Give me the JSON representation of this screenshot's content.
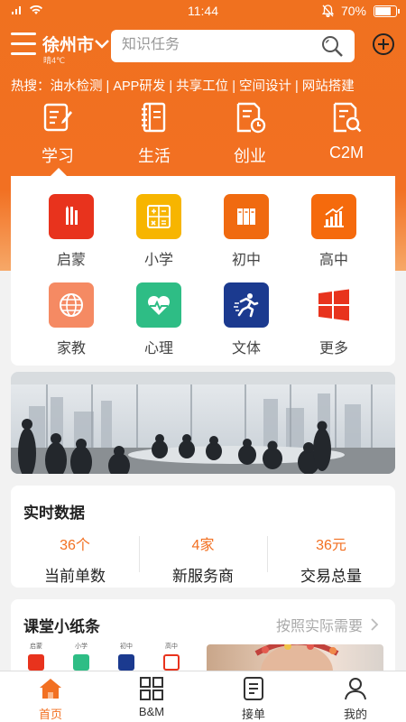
{
  "status": {
    "time": "11:44",
    "battery": "70%",
    "battery_level": 0.7
  },
  "header": {
    "city": "徐州市",
    "weather": "晴4℃",
    "search_placeholder": "知识任务"
  },
  "hot": {
    "text": "热搜：油水检测 | APP研发 | 共享工位 | 空间设计 | 网站搭建"
  },
  "categories": [
    {
      "label": "学习",
      "icon": "pencil-note-icon"
    },
    {
      "label": "生活",
      "icon": "notebook-icon"
    },
    {
      "label": "创业",
      "icon": "document-clock-icon"
    },
    {
      "label": "C2M",
      "icon": "document-search-icon"
    }
  ],
  "grid": [
    {
      "label": "启蒙",
      "color": "#e8331d",
      "icon": "crayon-icon"
    },
    {
      "label": "小学",
      "color": "#f7b500",
      "icon": "calculator-icon"
    },
    {
      "label": "初中",
      "color": "#f06a10",
      "icon": "books-icon"
    },
    {
      "label": "高中",
      "color": "#f56a0c",
      "icon": "growth-chart-icon"
    },
    {
      "label": "家教",
      "color": "#f58a63",
      "icon": "globe-icon"
    },
    {
      "label": "心理",
      "color": "#2ebd85",
      "icon": "heart-pulse-icon"
    },
    {
      "label": "文体",
      "color": "#1b3a8f",
      "icon": "runner-icon"
    },
    {
      "label": "更多",
      "color": "#e8331d",
      "icon": "windows-icon"
    }
  ],
  "realtime": {
    "title": "实时数据",
    "stats": [
      {
        "value": "36个",
        "label": "当前单数"
      },
      {
        "value": "4家",
        "label": "新服务商"
      },
      {
        "value": "36元",
        "label": "交易总量"
      }
    ]
  },
  "tips": {
    "title": "课堂小纸条",
    "more": "按照实际需要",
    "minis": [
      "启蒙",
      "小学",
      "初中",
      "高中"
    ]
  },
  "tabs": [
    {
      "label": "首页",
      "icon": "home-icon",
      "active": true
    },
    {
      "label": "B&M",
      "icon": "grid-icon"
    },
    {
      "label": "接单",
      "icon": "clipboard-icon"
    },
    {
      "label": "我的",
      "icon": "user-icon"
    }
  ]
}
